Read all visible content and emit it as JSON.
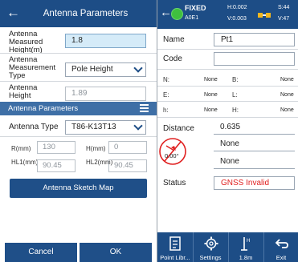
{
  "left": {
    "title": "Antenna Parameters",
    "measured_height_label": "Antenna Measured Height(m)",
    "measured_height_value": "1.8",
    "measurement_type_label": "Antenna Measurement Type",
    "measurement_type_value": "Pole Height",
    "antenna_height_label": "Antenna Height",
    "antenna_height_value": "1.89",
    "section_title": "Antenna Parameters",
    "antenna_type_label": "Antenna Type",
    "antenna_type_value": "T86-K13T13",
    "r_label": "R(mm)",
    "r_value": "130",
    "h_label": "H(mm)",
    "h_value": "0",
    "hl1_label": "HL1(mm)",
    "hl1_value": "90.45",
    "hl2_label": "HL2(mm)",
    "hl2_value": "90.45",
    "sketch_button": "Antenna Sketch Map",
    "cancel_button": "Cancel",
    "ok_button": "OK"
  },
  "right": {
    "fix_status": "FIXED",
    "age": "A0E1",
    "h_precision": "H:0.002",
    "v_precision": "V:0.003",
    "sats_used": "S:44",
    "sats_visible": "V:47",
    "name_label": "Name",
    "name_value": "Pt1",
    "code_label": "Code",
    "code_value": "",
    "n_label": "N:",
    "n_value": "None",
    "b_label": "B:",
    "b_value": "None",
    "e_label": "E:",
    "e_value": "None",
    "l_label": "L:",
    "l_value": "None",
    "hh_label": "h:",
    "hh_value": "None",
    "H_label": "H:",
    "H_value": "None",
    "distance_label": "Distance",
    "distance_value": "0.635",
    "tilt_value": "0.00°",
    "field1_value": "None",
    "field2_value": "None",
    "status_label": "Status",
    "status_value": "GNSS Invalid",
    "footer": [
      "Point Libr...",
      "Settings",
      "1.8m",
      "Exit"
    ]
  },
  "colors": {
    "header": "#1d4d86",
    "section": "#3e6fa6",
    "highlight_field": "#d5ebf8",
    "fixed_dot": "#3fbf3f",
    "status_red": "#e02020"
  }
}
